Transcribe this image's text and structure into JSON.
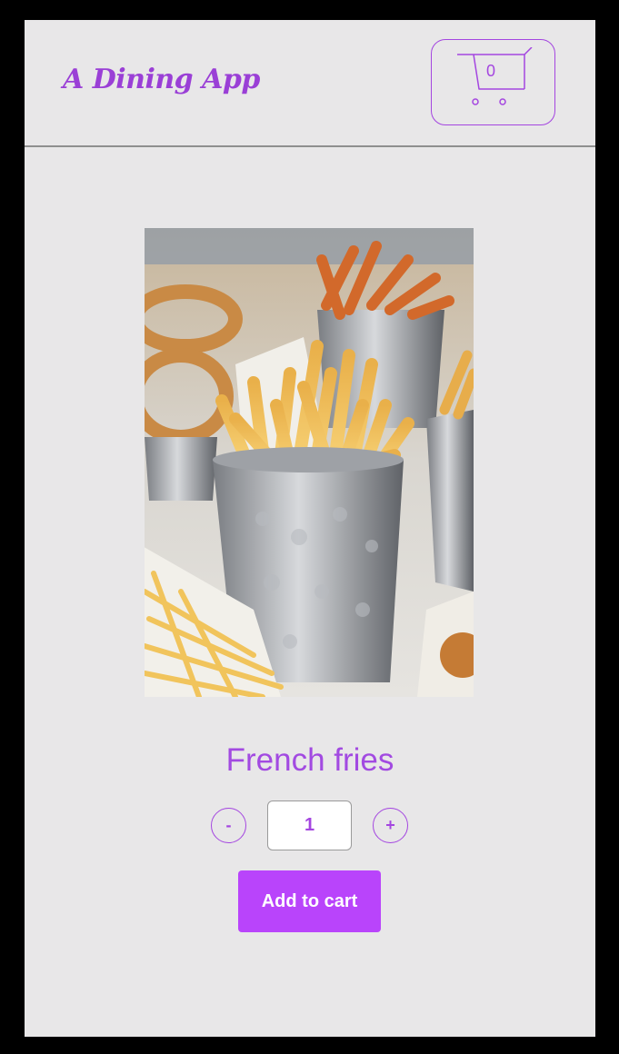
{
  "header": {
    "brand": "A Dining App",
    "cart": {
      "count": "0",
      "icon": "shopping-cart-icon"
    }
  },
  "product": {
    "title": "French fries",
    "image": {
      "alt": "French fries",
      "description_icon": "food-photo"
    },
    "quantity": {
      "minus_label": "-",
      "value": "1",
      "plus_label": "+"
    },
    "add_to_cart_label": "Add to cart"
  },
  "colors": {
    "accent": "#a446e0",
    "button": "#b944fb",
    "background": "#e8e7e8",
    "frame": "#000000"
  }
}
